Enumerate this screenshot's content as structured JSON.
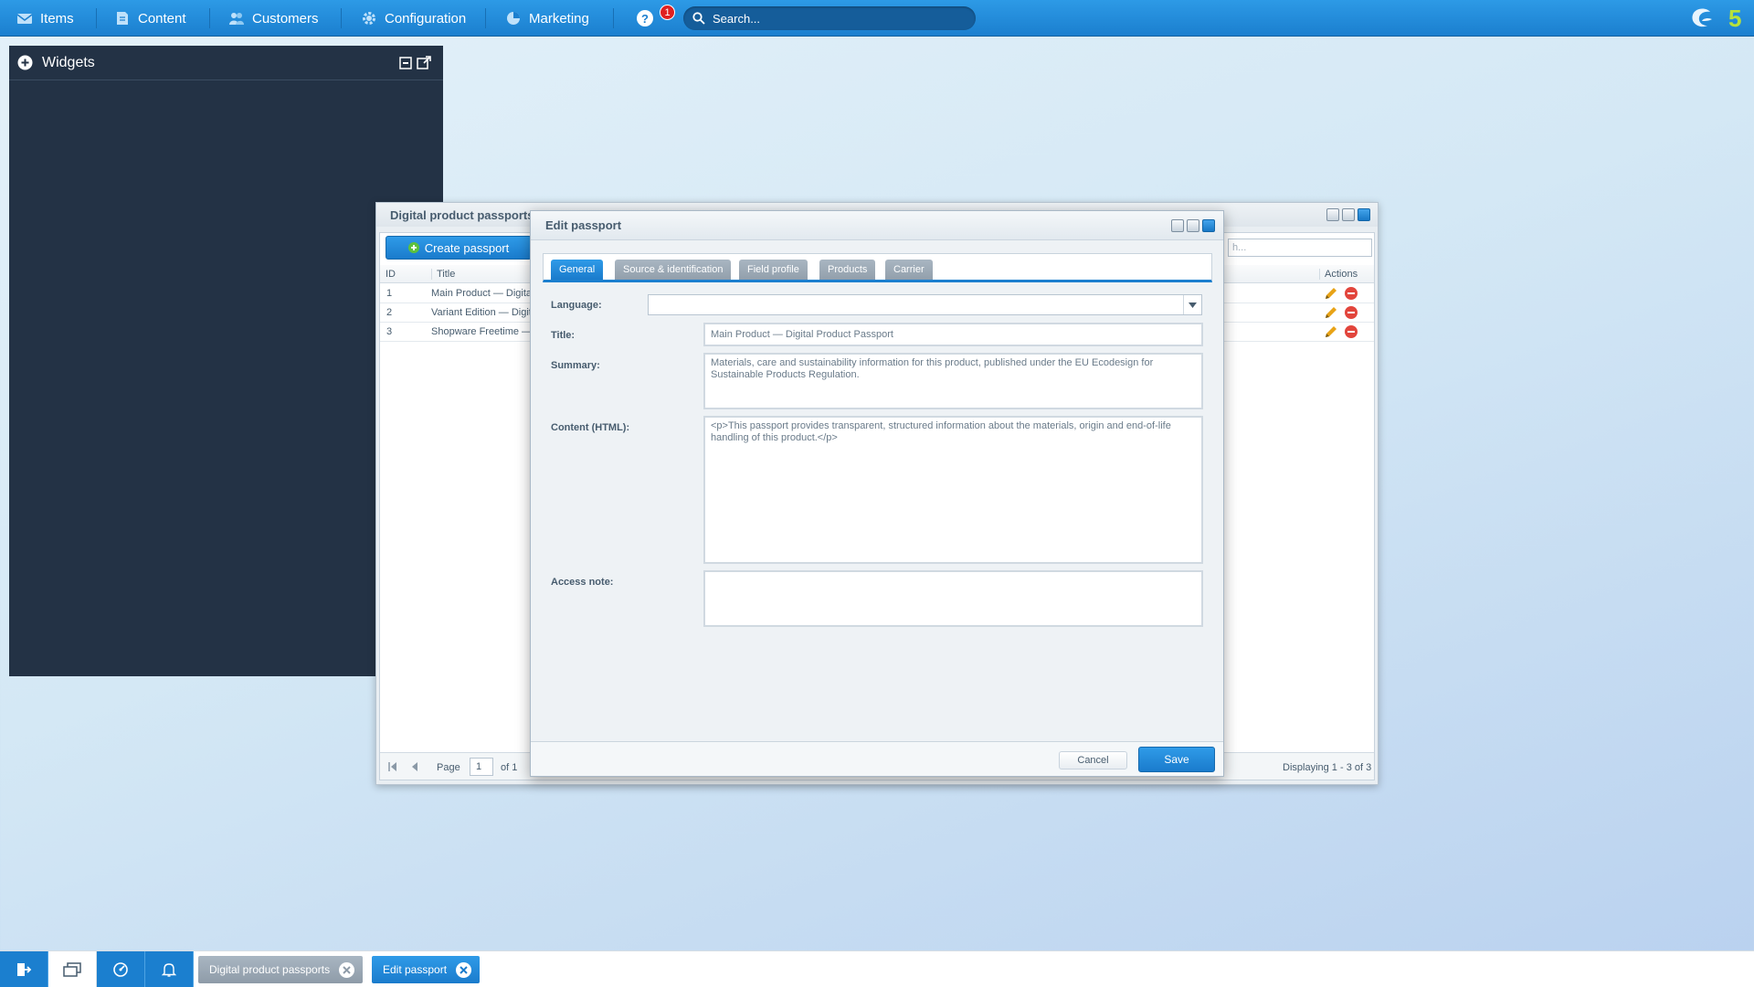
{
  "topbar": {
    "menu": [
      {
        "label": "Items",
        "icon": "envelope-icon"
      },
      {
        "label": "Content",
        "icon": "document-icon"
      },
      {
        "label": "Customers",
        "icon": "users-icon"
      },
      {
        "label": "Configuration",
        "icon": "gear-icon"
      },
      {
        "label": "Marketing",
        "icon": "pie-chart-icon"
      }
    ],
    "help_icon": "?",
    "notification_count": "1",
    "search_placeholder": "Search...",
    "brand_mark": "5"
  },
  "widgets": {
    "title": "Widgets"
  },
  "passports_window": {
    "title": "Digital product passports",
    "create_button": "Create passport",
    "search_placeholder": "h...",
    "columns": {
      "id": "ID",
      "title": "Title",
      "actions": "Actions"
    },
    "rows": [
      {
        "id": "1",
        "title": "Main Product — Digita"
      },
      {
        "id": "2",
        "title": "Variant Edition — Digit"
      },
      {
        "id": "3",
        "title": "Shopware Freetime —"
      }
    ],
    "pager": {
      "page_label": "Page",
      "page": "1",
      "of_label": "of 1",
      "displaying": "Displaying 1 - 3 of 3"
    }
  },
  "edit_window": {
    "title": "Edit passport",
    "tabs": [
      "General",
      "Source & identification",
      "Field profile",
      "Products",
      "Carrier"
    ],
    "active_tab": "General",
    "labels": {
      "language": "Language:",
      "title": "Title:",
      "summary": "Summary:",
      "content": "Content (HTML):",
      "access_note": "Access note:"
    },
    "values": {
      "language": "",
      "title": "Main Product — Digital Product Passport",
      "summary": "Materials, care and sustainability information for this product, published under the EU Ecodesign for Sustainable Products Regulation.",
      "content": "<p>This passport provides transparent, structured information about the materials, origin and end-of-life handling of this product.</p>",
      "access_note": ""
    },
    "cancel_button": "Cancel",
    "save_button": "Save"
  },
  "taskbar": {
    "tabs": [
      {
        "label": "Digital product passports",
        "active": false
      },
      {
        "label": "Edit passport",
        "active": true
      }
    ]
  },
  "colors": {
    "accent": "#1b7fcf",
    "widgets_bg": "#233245",
    "delete": "#e2453c",
    "edit": "#e8a317",
    "brand_green": "#b7e23a"
  }
}
